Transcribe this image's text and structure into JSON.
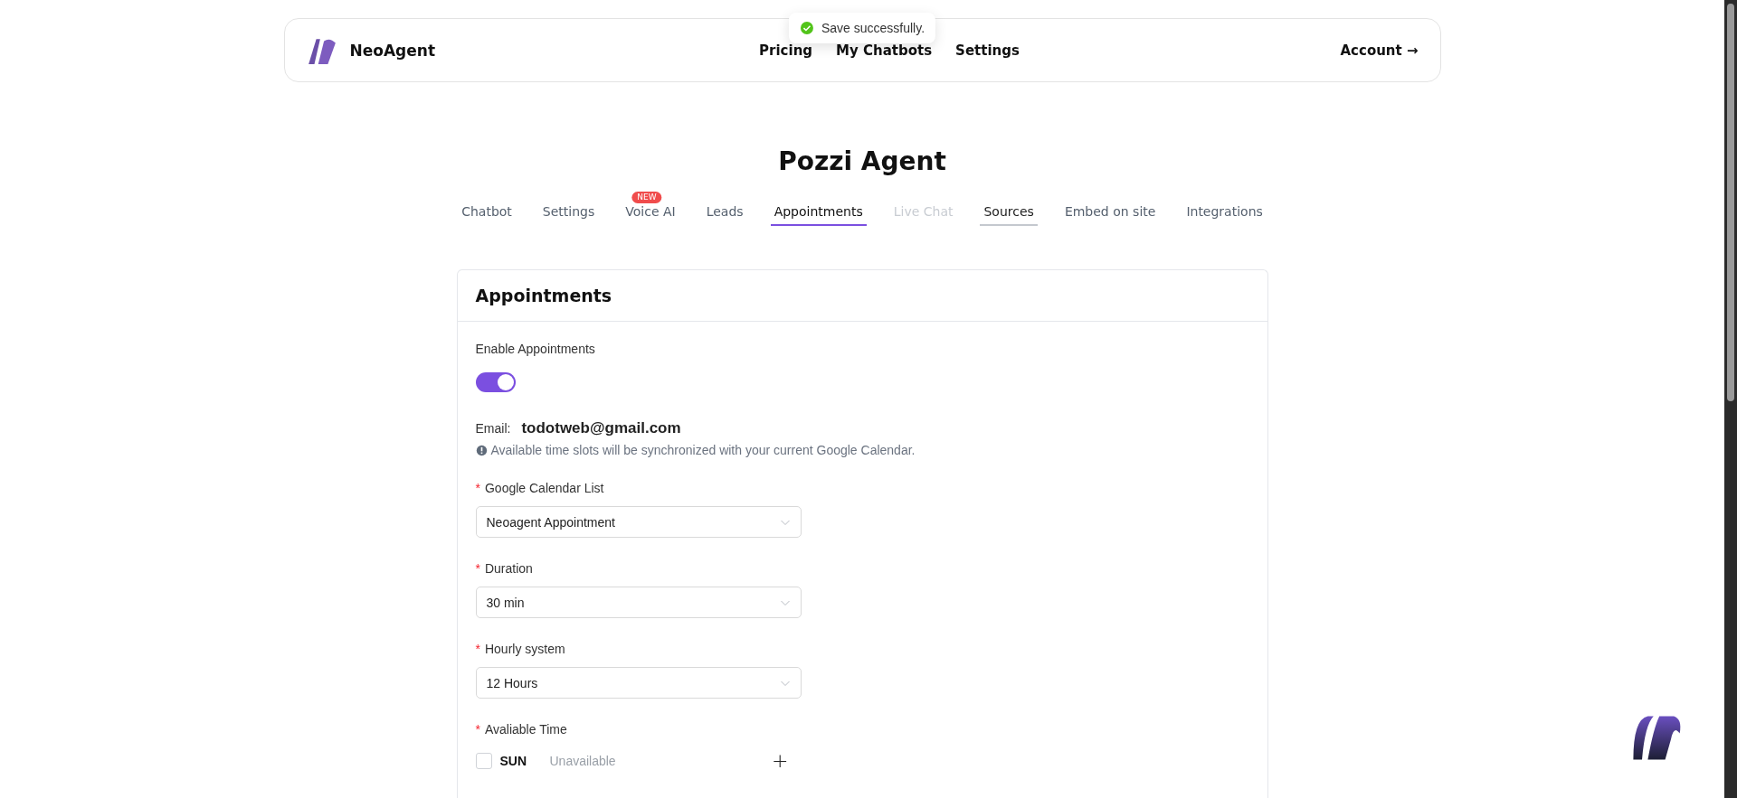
{
  "header": {
    "brand": "NeoAgent",
    "nav": [
      {
        "label": "Pricing"
      },
      {
        "label": "My Chatbots"
      },
      {
        "label": "Settings"
      }
    ],
    "account": "Account →"
  },
  "toast": {
    "message": "Save successfully."
  },
  "page_title": "Pozzi Agent",
  "tabs": [
    {
      "label": "Chatbot",
      "selected": false,
      "disabled": false,
      "hovered": false
    },
    {
      "label": "Settings",
      "selected": false,
      "disabled": false,
      "hovered": false
    },
    {
      "label": "Voice AI",
      "selected": false,
      "disabled": false,
      "hovered": false,
      "badge": "NEW"
    },
    {
      "label": "Leads",
      "selected": false,
      "disabled": false,
      "hovered": false
    },
    {
      "label": "Appointments",
      "selected": true,
      "disabled": false,
      "hovered": false
    },
    {
      "label": "Live Chat",
      "selected": false,
      "disabled": true,
      "hovered": false
    },
    {
      "label": "Sources",
      "selected": false,
      "disabled": false,
      "hovered": true
    },
    {
      "label": "Embed on site",
      "selected": false,
      "disabled": false,
      "hovered": false
    },
    {
      "label": "Integrations",
      "selected": false,
      "disabled": false,
      "hovered": false
    }
  ],
  "card": {
    "title": "Appointments",
    "enable": {
      "label": "Enable Appointments",
      "on": true
    },
    "email": {
      "label": "Email:",
      "value": "todotweb@gmail.com"
    },
    "info": "Available time slots will be synchronized with your current Google Calendar.",
    "selects": [
      {
        "label": "Google Calendar List",
        "required_mark": "*",
        "value": "Neoagent Appointment"
      },
      {
        "label": "Duration",
        "required_mark": "*",
        "value": "30 min"
      },
      {
        "label": "Hourly system",
        "required_mark": "*",
        "value": "12 Hours"
      }
    ],
    "available_time": {
      "label": "Avaliable Time",
      "required_mark": "*",
      "days": [
        {
          "day": "SUN",
          "checked": false,
          "status": "Unavailable",
          "add": "+"
        }
      ]
    }
  }
}
